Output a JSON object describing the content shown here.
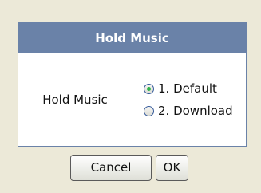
{
  "dialog": {
    "title": "Hold Music",
    "field_label": "Hold Music",
    "options": [
      {
        "label": "1. Default",
        "selected": true
      },
      {
        "label": "2. Download",
        "selected": false
      }
    ]
  },
  "buttons": {
    "cancel": "Cancel",
    "ok": "OK"
  },
  "colors": {
    "background": "#ece9d8",
    "header": "#6a82a8",
    "radio_selected": "#2fb34a"
  }
}
